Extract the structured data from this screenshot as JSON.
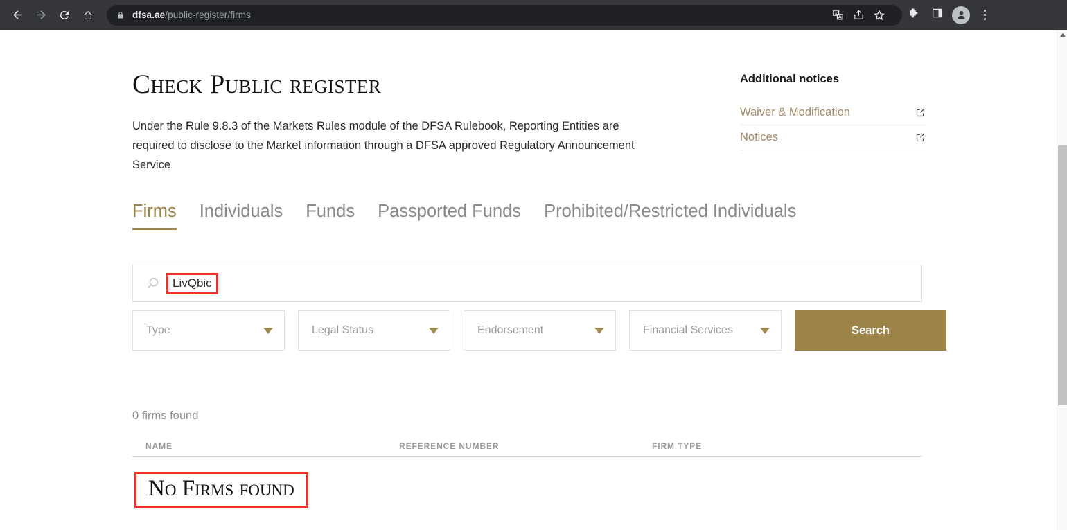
{
  "browser": {
    "back_icon": "back-arrow-icon",
    "forward_icon": "forward-arrow-icon",
    "reload_icon": "reload-icon",
    "home_icon": "home-icon",
    "lock_icon": "lock-icon",
    "url_domain": "dfsa.ae",
    "url_path": "/public-register/firms",
    "omnibox_actions": [
      {
        "name": "translate-icon"
      },
      {
        "name": "share-icon"
      },
      {
        "name": "bookmark-star-icon"
      }
    ],
    "toolbar_actions": [
      {
        "name": "extensions-puzzle-icon"
      },
      {
        "name": "side-panel-icon"
      },
      {
        "name": "profile-avatar-icon"
      },
      {
        "name": "chrome-menu-icon"
      }
    ]
  },
  "page": {
    "title": "Check Public register",
    "intro": "Under the Rule 9.8.3 of the Markets Rules module of the DFSA Rulebook, Reporting Entities are required to disclose to the Market information through a DFSA approved Regulatory Announcement Service"
  },
  "tabs": [
    {
      "label": "Firms",
      "active": true
    },
    {
      "label": "Individuals",
      "active": false
    },
    {
      "label": "Funds",
      "active": false
    },
    {
      "label": "Passported Funds",
      "active": false
    },
    {
      "label": "Prohibited/Restricted Individuals",
      "active": false
    }
  ],
  "search": {
    "icon": "search-magnifier-icon",
    "value": "LivQbic",
    "placeholder": "",
    "button_label": "Search"
  },
  "filters": [
    {
      "label": "Type",
      "value": ""
    },
    {
      "label": "Legal Status",
      "value": ""
    },
    {
      "label": "Endorsement",
      "value": ""
    },
    {
      "label": "Financial Services",
      "value": ""
    }
  ],
  "results": {
    "count_text": "0 firms found",
    "columns": [
      "NAME",
      "REFERENCE NUMBER",
      "FIRM TYPE"
    ],
    "rows": [],
    "empty_message": "No Firms found"
  },
  "sidebar": {
    "title": "Additional notices",
    "items": [
      {
        "label": "Waiver & Modification",
        "icon": "external-link-icon"
      },
      {
        "label": "Notices",
        "icon": "external-link-icon"
      }
    ]
  },
  "colors": {
    "accent_gold": "#9d8449",
    "link_gold": "#a08a6a",
    "annotation_red": "#f03127",
    "chrome_bar": "#35363a",
    "omnibox": "#202124"
  }
}
